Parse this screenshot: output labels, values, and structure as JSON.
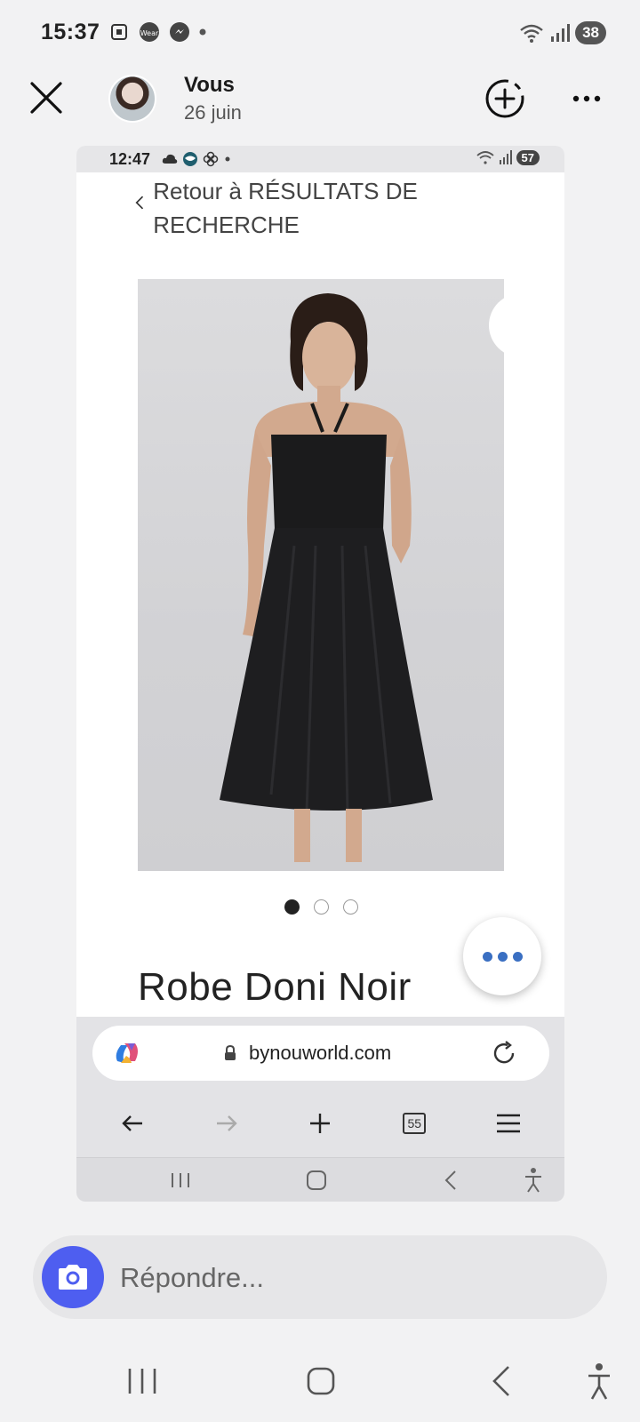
{
  "status_bar": {
    "time": "15:37",
    "battery": "38"
  },
  "story_header": {
    "user": "Vous",
    "date": "26 juin"
  },
  "screenshot": {
    "status_time": "12:47",
    "status_battery": "57",
    "back_link": "Retour à RÉSULTATS DE RECHERCHE",
    "product_title": "Robe Doni Noir",
    "carousel": {
      "total": 3,
      "active_index": 0
    },
    "browser": {
      "url": "bynouworld.com",
      "tabs_count": "55"
    }
  },
  "reply": {
    "placeholder": "Répondre..."
  },
  "colors": {
    "camera_button": "#4e5ef0",
    "fab_dots": "#3a6fc2"
  }
}
